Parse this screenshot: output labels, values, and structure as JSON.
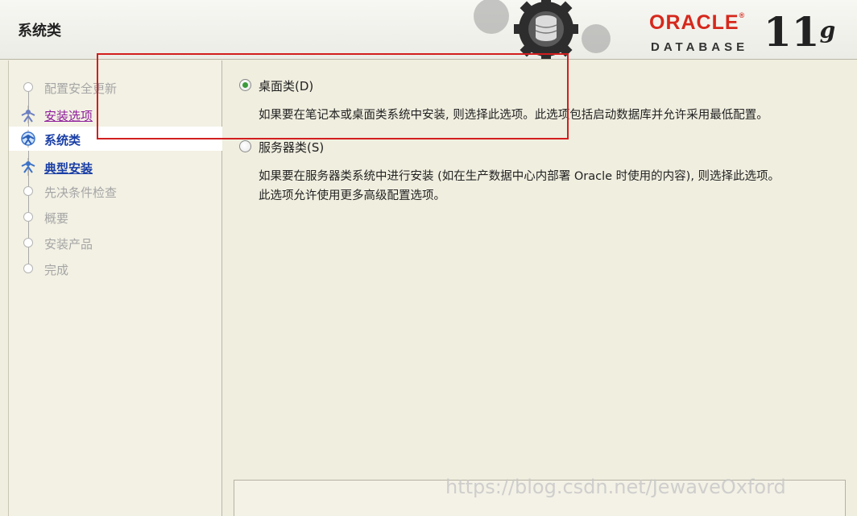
{
  "window": {
    "title": "系统类"
  },
  "brand": {
    "oracle": "ORACLE",
    "reg": "®",
    "database": "DATABASE",
    "version": "11",
    "version_sup": "g"
  },
  "steps": [
    {
      "label": "配置安全更新",
      "state": "disabled"
    },
    {
      "label": "安装选项",
      "state": "visited"
    },
    {
      "label": "系统类",
      "state": "current"
    },
    {
      "label": "典型安装",
      "state": "link"
    },
    {
      "label": "先决条件检查",
      "state": "disabled"
    },
    {
      "label": "概要",
      "state": "disabled"
    },
    {
      "label": "安装产品",
      "state": "disabled"
    },
    {
      "label": "完成",
      "state": "disabled"
    }
  ],
  "options": {
    "desktop": {
      "label": "桌面类(D)",
      "selected": true,
      "description": "如果要在笔记本或桌面类系统中安装, 则选择此选项。此选项包括启动数据库并允许采用最低配置。"
    },
    "server": {
      "label": "服务器类(S)",
      "selected": false,
      "description_line1": "如果要在服务器类系统中进行安装 (如在生产数据中心内部署 Oracle 时使用的内容), 则选择此选项。",
      "description_line2": "此选项允许使用更多高级配置选项。"
    }
  },
  "watermark": "https://blog.csdn.net/JewaveOxford",
  "colors": {
    "highlight": "#d21f1f",
    "oracle_red": "#d6281c",
    "nav_link": "#1a3fa6",
    "nav_visited": "#8e1d9b"
  }
}
